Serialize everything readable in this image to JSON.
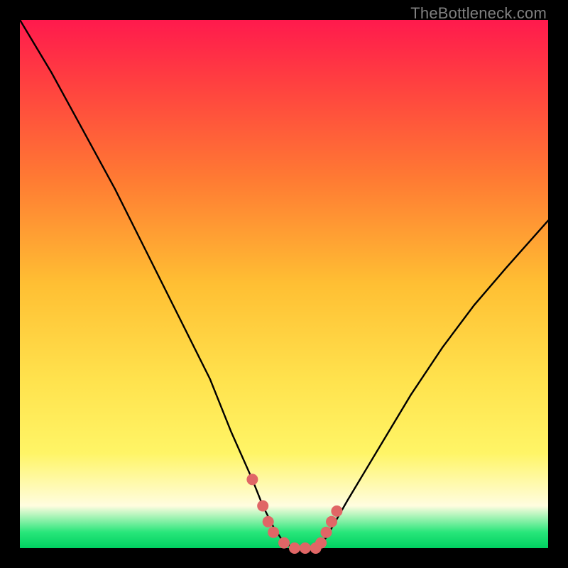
{
  "watermark": "TheBottleneck.com",
  "chart_data": {
    "type": "line",
    "title": "",
    "xlabel": "",
    "ylabel": "",
    "xlim": [
      0,
      100
    ],
    "ylim": [
      0,
      100
    ],
    "series": [
      {
        "name": "bottleneck-curve",
        "x": [
          0,
          6,
          12,
          18,
          24,
          30,
          36,
          40,
          44,
          46,
          48,
          50,
          52,
          54,
          56,
          58,
          62,
          68,
          74,
          80,
          86,
          92,
          100
        ],
        "values": [
          100,
          90,
          79,
          68,
          56,
          44,
          32,
          22,
          13,
          8,
          4,
          1,
          0,
          0,
          0,
          2,
          9,
          19,
          29,
          38,
          46,
          53,
          62
        ]
      }
    ],
    "markers": [
      {
        "x": 44,
        "y": 13
      },
      {
        "x": 46,
        "y": 8
      },
      {
        "x": 47,
        "y": 5
      },
      {
        "x": 48,
        "y": 3
      },
      {
        "x": 50,
        "y": 1
      },
      {
        "x": 52,
        "y": 0
      },
      {
        "x": 54,
        "y": 0
      },
      {
        "x": 56,
        "y": 0
      },
      {
        "x": 57,
        "y": 1
      },
      {
        "x": 58,
        "y": 3
      },
      {
        "x": 59,
        "y": 5
      },
      {
        "x": 60,
        "y": 7
      }
    ],
    "colors": {
      "curve": "#000000",
      "marker": "#e06666"
    }
  }
}
